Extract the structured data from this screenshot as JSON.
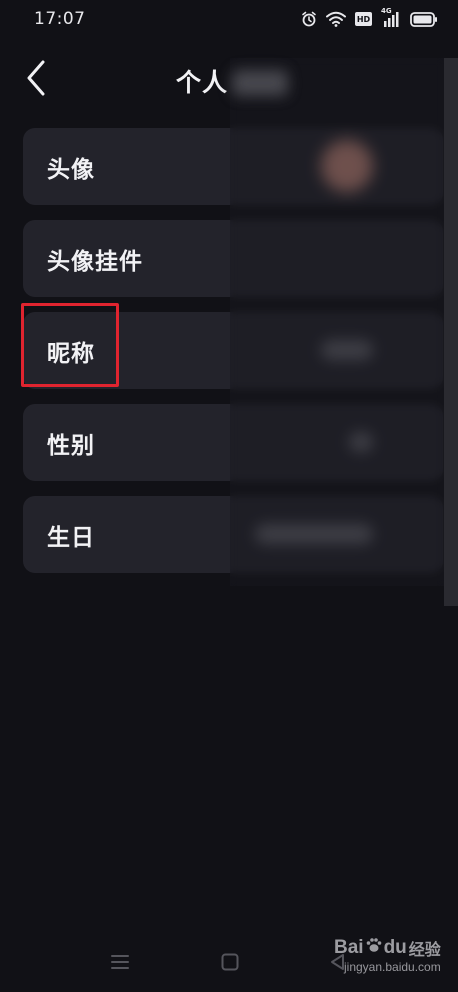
{
  "status_bar": {
    "time": "17:07",
    "hd_label": "HD",
    "network_label": "4G",
    "icons": [
      "alarm-icon",
      "wifi-icon",
      "hd-icon",
      "signal-icon",
      "battery-icon"
    ]
  },
  "header": {
    "back_icon": "chevron-left-icon",
    "title": "个人"
  },
  "settings": {
    "rows": [
      {
        "label": "头像"
      },
      {
        "label": "头像挂件"
      },
      {
        "label": "昵称"
      },
      {
        "label": "性别"
      },
      {
        "label": "生日"
      }
    ]
  },
  "nav_bar": {
    "icons": [
      "menu-icon",
      "home-icon",
      "back-triangle-icon"
    ]
  },
  "watermark": {
    "brand_left": "Bai",
    "brand_right": "du",
    "brand_cn": "经验",
    "url": "jingyan.baidu.com"
  },
  "colors": {
    "background": "#111116",
    "row_background": "#23232b",
    "highlight": "#e0242f",
    "text": "#f2f2f5"
  }
}
